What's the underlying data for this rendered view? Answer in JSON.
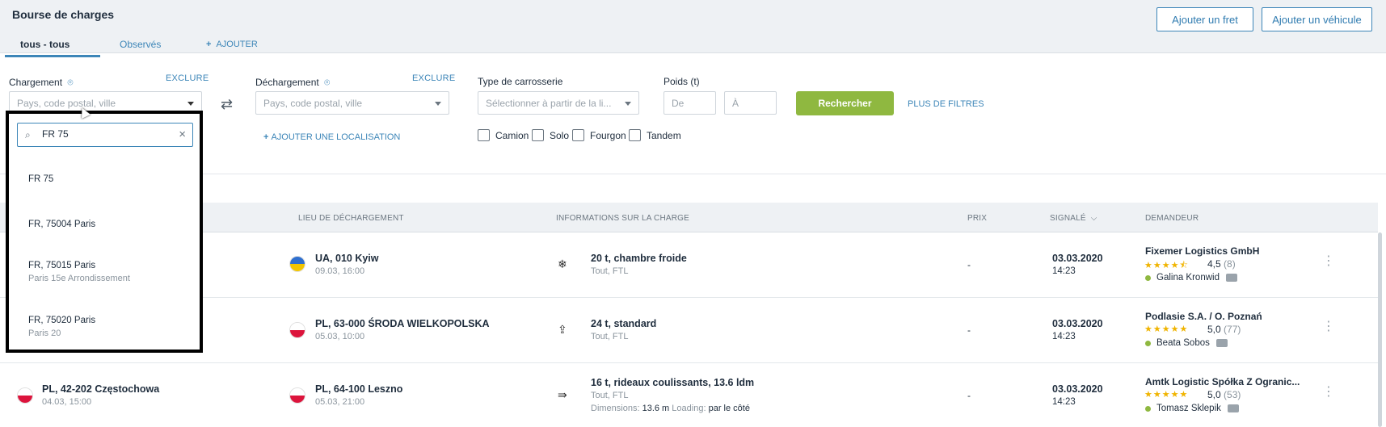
{
  "header": {
    "title": "Bourse de charges",
    "add_freight": "Ajouter un fret",
    "add_vehicle": "Ajouter un véhicule",
    "tabs": [
      {
        "label": "tous - tous"
      },
      {
        "label": "Observés"
      },
      {
        "label": "AJOUTER"
      }
    ]
  },
  "filters": {
    "loading_label": "Chargement",
    "unloading_label": "Déchargement",
    "exclude": "EXCLURE",
    "location_placeholder": "Pays, code postal, ville",
    "body_type_label": "Type de carrosserie",
    "body_type_placeholder": "Sélectionner à partir de la li...",
    "weight_label": "Poids (t)",
    "weight_from": "De",
    "weight_to": "À",
    "search": "Rechercher",
    "more_filters": "PLUS DE FILTRES",
    "add_location": "AJOUTER UNE LOCALISATION",
    "vehicle_types": [
      "Camion",
      "Solo",
      "Fourgon",
      "Tandem"
    ]
  },
  "dropdown": {
    "query": "FR 75",
    "options": [
      {
        "main": "FR 75",
        "sub": ""
      },
      {
        "main": "FR, 75004 Paris",
        "sub": ""
      },
      {
        "main": "FR, 75015 Paris",
        "sub": "Paris 15e Arrondissement"
      },
      {
        "main": "FR, 75020 Paris",
        "sub": "Paris 20"
      }
    ]
  },
  "table": {
    "headers": {
      "unloading": "LIEU DE DÉCHARGEMENT",
      "info": "INFORMATIONS SUR LA CHARGE",
      "price": "PRIX",
      "reported": "SIGNALÉ",
      "requester": "DEMANDEUR"
    },
    "rows": [
      {
        "load_place": "",
        "load_date": "",
        "unload_place": "UA, 010 Kyiw",
        "unload_date": "09.03, 16:00",
        "cargo": "20 t, chambre froide",
        "cargo_sub": "Tout, FTL",
        "price": "-",
        "date": "03.03.2020",
        "time": "14:23",
        "company": "Fixemer Logistics GmbH",
        "stars": "★★★★⯪",
        "rating": "4,5",
        "count": "(8)",
        "person": "Galina Kronwid",
        "cargo_icon": "snowflake-icon"
      },
      {
        "load_place": "",
        "load_date": "",
        "unload_place": "PL, 63-000 ŚRODA WIELKOPOLSKA",
        "unload_date": "05.03, 10:00",
        "cargo": "24 t, standard",
        "cargo_sub": "Tout, FTL",
        "price": "-",
        "date": "03.03.2020",
        "time": "14:23",
        "company": "Podlasie S.A. / O. Poznań",
        "stars": "★★★★★",
        "rating": "5,0",
        "count": "(77)",
        "person": "Beata Sobos",
        "cargo_icon": "upload-icon"
      },
      {
        "load_place": "PL, 42-202 Częstochowa",
        "load_date": "04.03, 15:00",
        "unload_place": "PL, 64-100 Leszno",
        "unload_date": "05.03, 21:00",
        "cargo": "16 t, rideaux coulissants, 13.6 ldm",
        "cargo_sub": "Tout, FTL",
        "dim_label": "Dimensions:",
        "dim_value": "13.6 m",
        "loading_label": "Loading:",
        "loading_value": "par le côté",
        "price": "-",
        "date": "03.03.2020",
        "time": "14:23",
        "company": "Amtk Logistic Spółka Z Ogranic...",
        "stars": "★★★★★",
        "rating": "5,0",
        "count": "(53)",
        "person": "Tomasz Sklepik",
        "cargo_icon": "side-load-icon"
      }
    ]
  },
  "colors": {
    "accent": "#3d86b8",
    "search_button": "#8fb840",
    "online_dot": "#8fb840",
    "star": "#f0b400"
  }
}
